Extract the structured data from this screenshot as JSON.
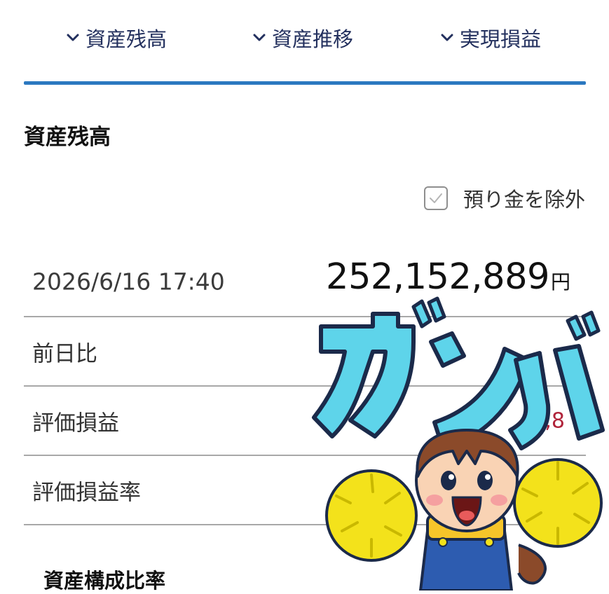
{
  "nav": {
    "tabs": [
      {
        "label": "資産残高",
        "icon": "chevron-down-icon"
      },
      {
        "label": "資産推移",
        "icon": "chevron-down-icon"
      },
      {
        "label": "実現損益",
        "icon": "chevron-down-icon"
      }
    ],
    "accent_color": "#2b78c0"
  },
  "section": {
    "title": "資産残高",
    "exclude_deposit": {
      "label": "預り金を除外",
      "checked": true
    }
  },
  "summary": {
    "datetime": "2026/6/16 17:40",
    "total_value": "252,152,889",
    "total_unit": "円",
    "rows": [
      {
        "label": "前日比",
        "value": ""
      },
      {
        "label": "評価損益",
        "value": "3,8"
      },
      {
        "label": "評価損益率",
        "value": ""
      }
    ]
  },
  "composition": {
    "title": "資産構成比率"
  },
  "sticker": {
    "text": "ガンバレ"
  }
}
